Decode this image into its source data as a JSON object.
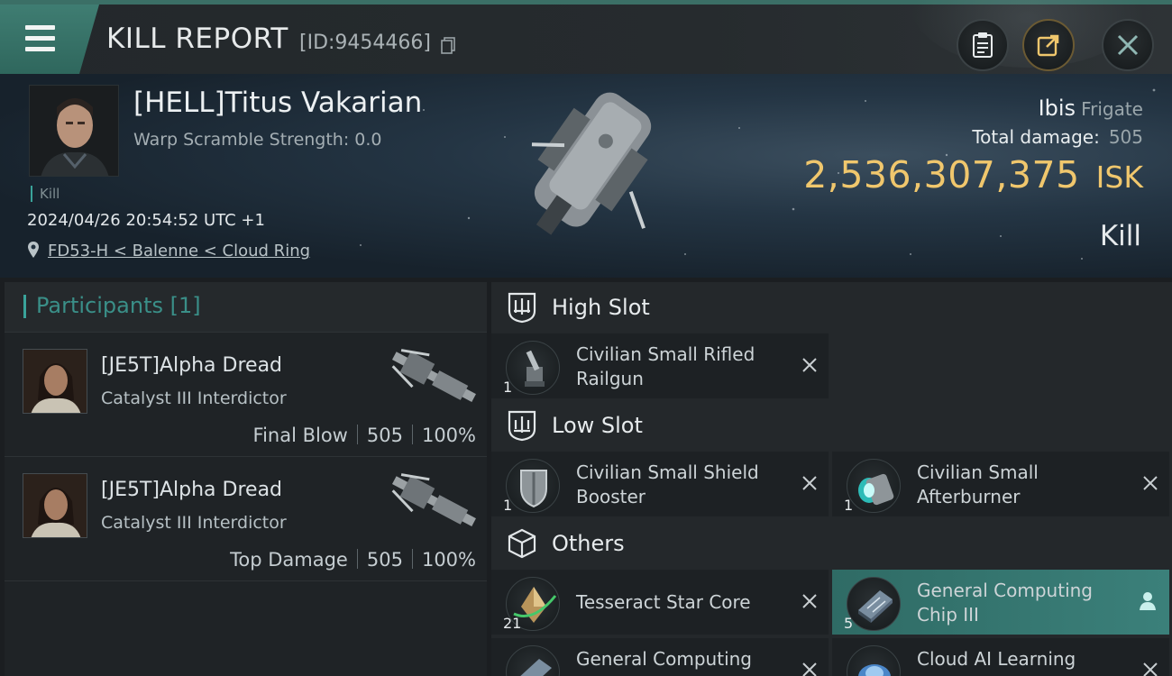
{
  "header": {
    "title": "KILL REPORT",
    "id_text": "[ID:9454466]",
    "buttons": [
      "clipboard-icon",
      "share-icon",
      "close-icon"
    ]
  },
  "victim": {
    "name": "[HELL]Titus Vakarian",
    "warp_scramble": "Warp Scramble Strength: 0.0",
    "tag": "Kill",
    "datetime": "2024/04/26 20:54:52 UTC +1",
    "location": "FD53-H < Balenne < Cloud Ring",
    "ship_name": "Ibis",
    "ship_class": "Frigate",
    "total_damage_label": "Total damage:",
    "total_damage_value": "505",
    "isk_value": "2,536,307,375",
    "isk_unit": "ISK",
    "result": "Kill"
  },
  "participants": {
    "title": "Participants [1]",
    "rows": [
      {
        "name": "[JE5T]Alpha Dread",
        "ship": "Catalyst III Interdictor",
        "role": "Final Blow",
        "damage": "505",
        "percent": "100%"
      },
      {
        "name": "[JE5T]Alpha Dread",
        "ship": "Catalyst III Interdictor",
        "role": "Top Damage",
        "damage": "505",
        "percent": "100%"
      }
    ]
  },
  "slots": {
    "high": {
      "title": "High Slot",
      "items": [
        {
          "name": "Civilian Small Rifled Railgun",
          "qty": "1",
          "icon": "railgun-icon"
        }
      ]
    },
    "low": {
      "title": "Low Slot",
      "items": [
        {
          "name": "Civilian Small Shield Booster",
          "qty": "1",
          "icon": "shield-booster-icon"
        },
        {
          "name": "Civilian Small Afterburner",
          "qty": "1",
          "icon": "afterburner-icon"
        }
      ]
    },
    "others": {
      "title": "Others",
      "items": [
        {
          "name": "Tesseract Star Core",
          "qty": "21",
          "icon": "star-core-icon"
        },
        {
          "name": "General Computing Chip III",
          "qty": "5",
          "icon": "computing-chip-icon"
        },
        {
          "name": "General Computing",
          "qty": "",
          "icon": "computing-chip-icon"
        },
        {
          "name": "Cloud AI Learning",
          "qty": "",
          "icon": "ai-learning-icon"
        }
      ]
    }
  },
  "colors": {
    "accent": "#3aa39a",
    "isk": "#f0c76d",
    "highlight": "#3b807a"
  }
}
